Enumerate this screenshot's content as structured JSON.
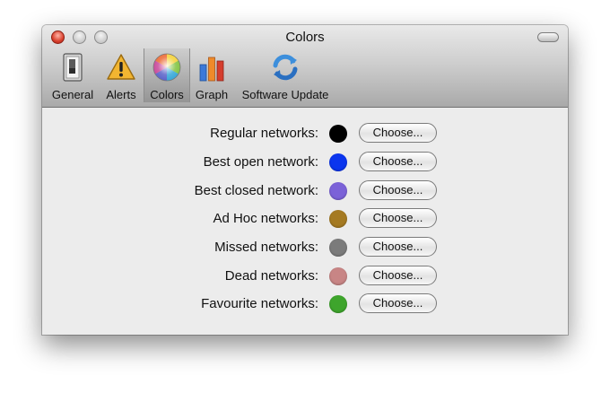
{
  "window": {
    "title": "Colors"
  },
  "toolbar": {
    "items": [
      {
        "label": "General",
        "icon": "switch-icon"
      },
      {
        "label": "Alerts",
        "icon": "warning-icon"
      },
      {
        "label": "Colors",
        "icon": "color-wheel-icon",
        "selected": true
      },
      {
        "label": "Graph",
        "icon": "bar-chart-icon"
      },
      {
        "label": "Software Update",
        "icon": "refresh-icon"
      }
    ]
  },
  "colors": {
    "button_label": "Choose...",
    "rows": [
      {
        "label": "Regular networks:",
        "color": "#000000"
      },
      {
        "label": "Best open network:",
        "color": "#0b35ee"
      },
      {
        "label": "Best closed network:",
        "color": "#7b62d8"
      },
      {
        "label": "Ad Hoc networks:",
        "color": "#a57a22"
      },
      {
        "label": "Missed networks:",
        "color": "#7b7b7b"
      },
      {
        "label": "Dead networks:",
        "color": "#c88585"
      },
      {
        "label": "Favourite networks:",
        "color": "#3ea52c"
      }
    ]
  }
}
